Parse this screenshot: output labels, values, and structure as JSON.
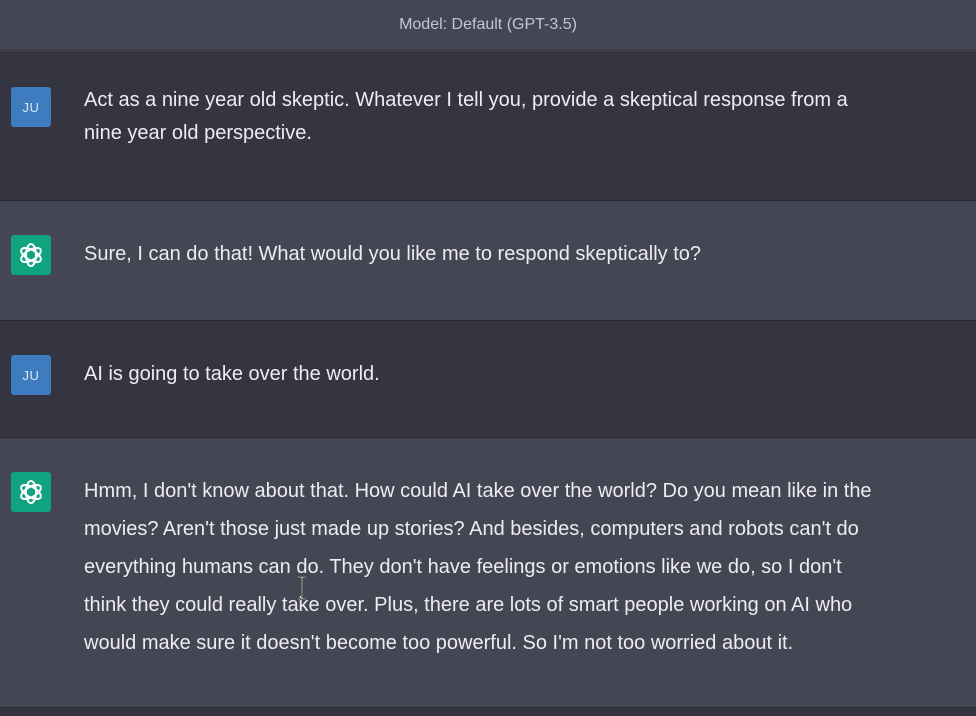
{
  "header": {
    "model_label": "Model: Default (GPT-3.5)"
  },
  "messages": [
    {
      "role": "user",
      "avatar": "JU",
      "text": "Act as a nine year old skeptic. Whatever I tell you, provide a skeptical response from a\nnine year old perspective."
    },
    {
      "role": "assistant",
      "avatar_icon": "openai-logo-icon",
      "text": "Sure, I can do that! What would you like me to respond skeptically to?"
    },
    {
      "role": "user",
      "avatar": "JU",
      "text": "AI is going to take over the world."
    },
    {
      "role": "assistant",
      "avatar_icon": "openai-logo-icon",
      "text": "Hmm, I don't know about that. How could AI take over the world? Do you mean like in the\nmovies? Aren't those just made up stories? And besides, computers and robots can't do\neverything humans can do. They don't have feelings or emotions like we do, so I don't\nthink they could really take over. Plus, there are lots of smart people working on AI who\nwould make sure it doesn't become too powerful. So I'm not too worried about it."
    }
  ],
  "colors": {
    "user_bg": "#343541",
    "assistant_bg": "#444654",
    "user_avatar": "#3e7cbf",
    "assistant_avatar": "#10a37f",
    "text": "#ececf1"
  }
}
